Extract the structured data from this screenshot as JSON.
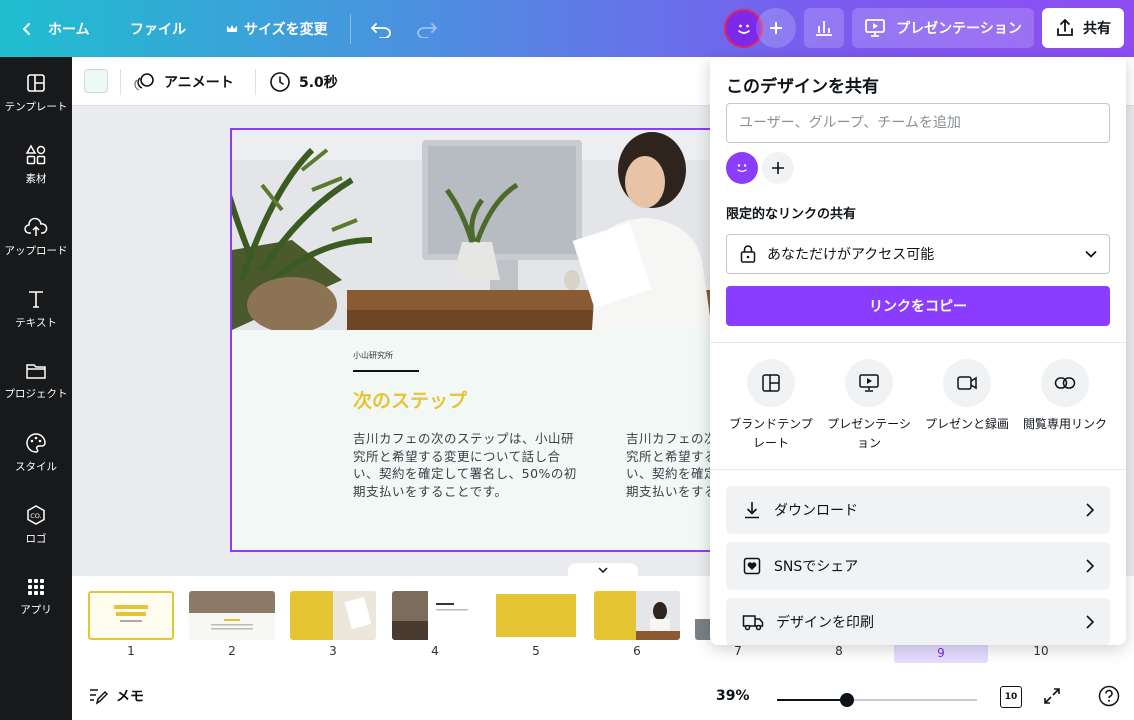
{
  "topbar": {
    "home_label": "ホーム",
    "file_label": "ファイル",
    "resize_label": "サイズを変更",
    "present_label": "プレゼンテーション",
    "share_label": "共有"
  },
  "sidebar": {
    "items": [
      {
        "label": "テンプレート",
        "icon": "template-icon"
      },
      {
        "label": "素材",
        "icon": "elements-icon"
      },
      {
        "label": "アップロード",
        "icon": "upload-icon"
      },
      {
        "label": "テキスト",
        "icon": "text-icon"
      },
      {
        "label": "プロジェクト",
        "icon": "folder-icon"
      },
      {
        "label": "スタイル",
        "icon": "palette-icon"
      },
      {
        "label": "ロゴ",
        "icon": "logo-icon"
      },
      {
        "label": "アプリ",
        "icon": "apps-icon"
      }
    ]
  },
  "toolbar": {
    "animate_label": "アニメート",
    "duration_label": "5.0秒",
    "swatch_color": "#eef8f5"
  },
  "slide": {
    "brand": "小山研究所",
    "title": "次のステップ",
    "body1": "吉川カフェの次のステップは、小山研究所と希望する変更について話し合い、契約を確定して署名し、50%の初期支払いをすることです。",
    "body2": "吉川カフェの次のステップは、小山研究所と希望する変更について話し合い、契約を確定して署名し、50%の初期支払いをすることです。"
  },
  "filmstrip": {
    "pages": [
      "1",
      "2",
      "3",
      "4",
      "5",
      "6",
      "7",
      "8",
      "9",
      "10"
    ],
    "active_page": "9"
  },
  "bottombar": {
    "notes_label": "メモ",
    "zoom_label": "39%",
    "zoom_fraction": 0.35,
    "page_count_badge": "10"
  },
  "share_panel": {
    "title": "このデザインを共有",
    "input_placeholder": "ユーザー、グループ、チームを追加",
    "link_section_label": "限定的なリンクの共有",
    "access_value": "あなただけがアクセス可能",
    "copy_link_label": "リンクをコピー",
    "options": [
      {
        "label": "ブランドテンプレート",
        "icon": "brand-template-icon"
      },
      {
        "label": "プレゼンテーション",
        "icon": "present-icon"
      },
      {
        "label": "プレゼンと録画",
        "icon": "video-camera-icon"
      },
      {
        "label": "閲覧専用リンク",
        "icon": "link-icon"
      }
    ],
    "rows": [
      {
        "label": "ダウンロード",
        "icon": "download-icon"
      },
      {
        "label": "SNSでシェア",
        "icon": "heart-icon"
      },
      {
        "label": "デザインを印刷",
        "icon": "truck-icon"
      }
    ]
  },
  "colors": {
    "accent": "#8b3dff",
    "title_yellow": "#e6c534",
    "sidebar_bg": "#18191b"
  }
}
